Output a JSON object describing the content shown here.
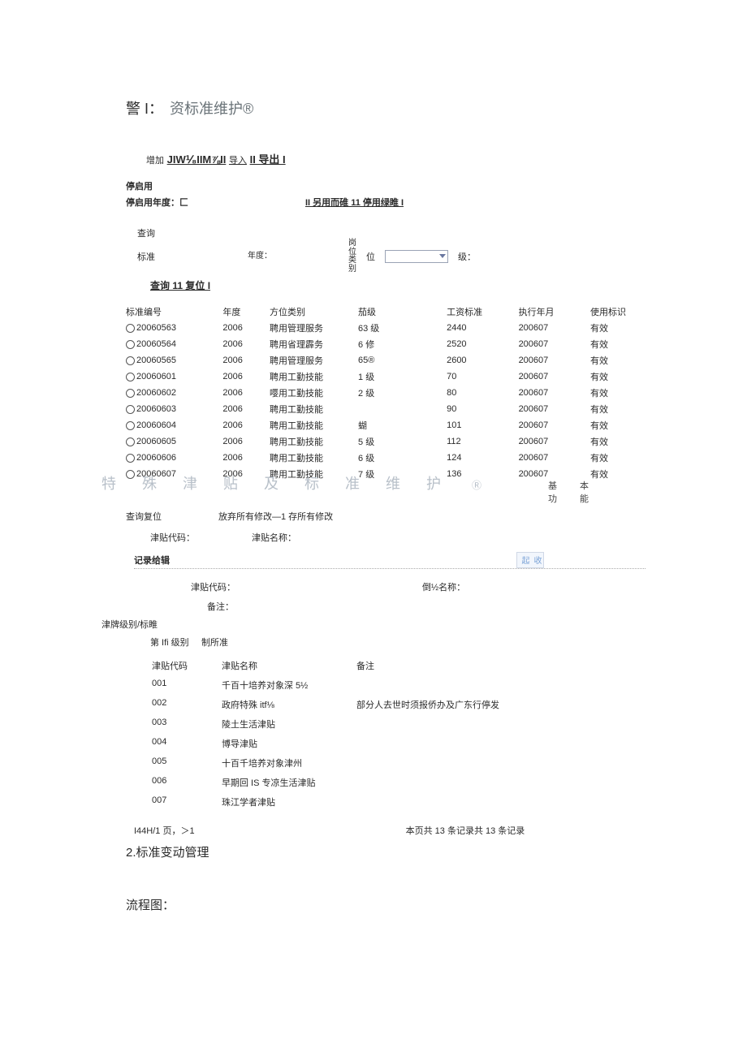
{
  "title_prefix": "警 I：",
  "title_main": "资标准维护®",
  "toolbar": {
    "add": "增加",
    "mid": "JIW⅟₈IIM⅞II",
    "import": "导入",
    "export": "II 导出 I"
  },
  "enable": {
    "section": "停启用",
    "year_label": "停启用年度：匚",
    "btn1": "II 另用而碓 11 停用绿睢 I"
  },
  "query": {
    "q": "查询",
    "std": "标准",
    "year": "年度：",
    "post_cat": "岗位类别",
    "post": "位",
    "level": "级：",
    "btns": "查询 11 复位 I"
  },
  "table": {
    "headers": [
      "标准编号",
      "年度",
      "方位类别",
      "茄级",
      "工资标准",
      "执行年月",
      "使用标识"
    ],
    "rows": [
      [
        "20060563",
        "2006",
        "聘用管理服务",
        "63 级",
        "2440",
        "200607",
        "有效"
      ],
      [
        "20060564",
        "2006",
        "聘用省理霹务",
        "6 修",
        "2520",
        "200607",
        "有效"
      ],
      [
        "20060565",
        "2006",
        "聘用管理服务",
        "65®",
        "2600",
        "200607",
        "有效"
      ],
      [
        "20060601",
        "2006",
        "聘用工勤技能",
        "1 级",
        "70",
        "200607",
        "有效"
      ],
      [
        "20060602",
        "2006",
        "嘤用工勤技能",
        "2 级",
        "80",
        "200607",
        "有效"
      ],
      [
        "20060603",
        "2006",
        "聘用工勤技能",
        "",
        "90",
        "200607",
        "有效"
      ],
      [
        "20060604",
        "2006",
        "聘用工勤技能",
        "蝴",
        "101",
        "200607",
        "有效"
      ],
      [
        "20060605",
        "2006",
        "聘用工勤技能",
        "5 级",
        "112",
        "200607",
        "有效"
      ],
      [
        "20060606",
        "2006",
        "聘用工勤技能",
        "6 级",
        "124",
        "200607",
        "有效"
      ],
      [
        "20060607",
        "2006",
        "聘用工勤技能",
        "7 级",
        "136",
        "200607",
        "有效"
      ]
    ]
  },
  "section2": {
    "title": "特殊津贴及标准维护",
    "reg": "Ⓡ",
    "subtitle": "基本功能"
  },
  "sec2_ops": {
    "left": "查询复位",
    "right": "放弃所有修改—1 存所有修改"
  },
  "form": {
    "code": "津贴代码：",
    "name": "津贴名称："
  },
  "record_edit": "记录给辑",
  "sidebar": "收起",
  "inner": {
    "code": "津贴代码：",
    "name": "倒½名称："
  },
  "note_label": "备注：",
  "level_header": "津牌级别/标睢",
  "level_row": {
    "a": "第 Ifi 级别",
    "b": "制所准"
  },
  "tbl2": {
    "headers": [
      "津贴代码",
      "津贴名称",
      "备注"
    ],
    "rows": [
      [
        "001",
        "千百十培养对象深 5½",
        ""
      ],
      [
        "002",
        "政府特殊 itf⅛",
        "部分人去世时须报侨办及广东行停发"
      ],
      [
        "003",
        "陵土生活津贴",
        ""
      ],
      [
        "004",
        "博导津贴",
        ""
      ],
      [
        "005",
        "十百千培养对象津州",
        ""
      ],
      [
        "006",
        "早期回 IS 专凉生活津贴",
        ""
      ],
      [
        "007",
        "珠江学者津贴",
        ""
      ]
    ]
  },
  "footer": {
    "left": "I44H/1 页，＞1",
    "right": "本页共 13 条记录共 13 条记录"
  },
  "h2": "2.标准变动管理",
  "flow": "流程图："
}
